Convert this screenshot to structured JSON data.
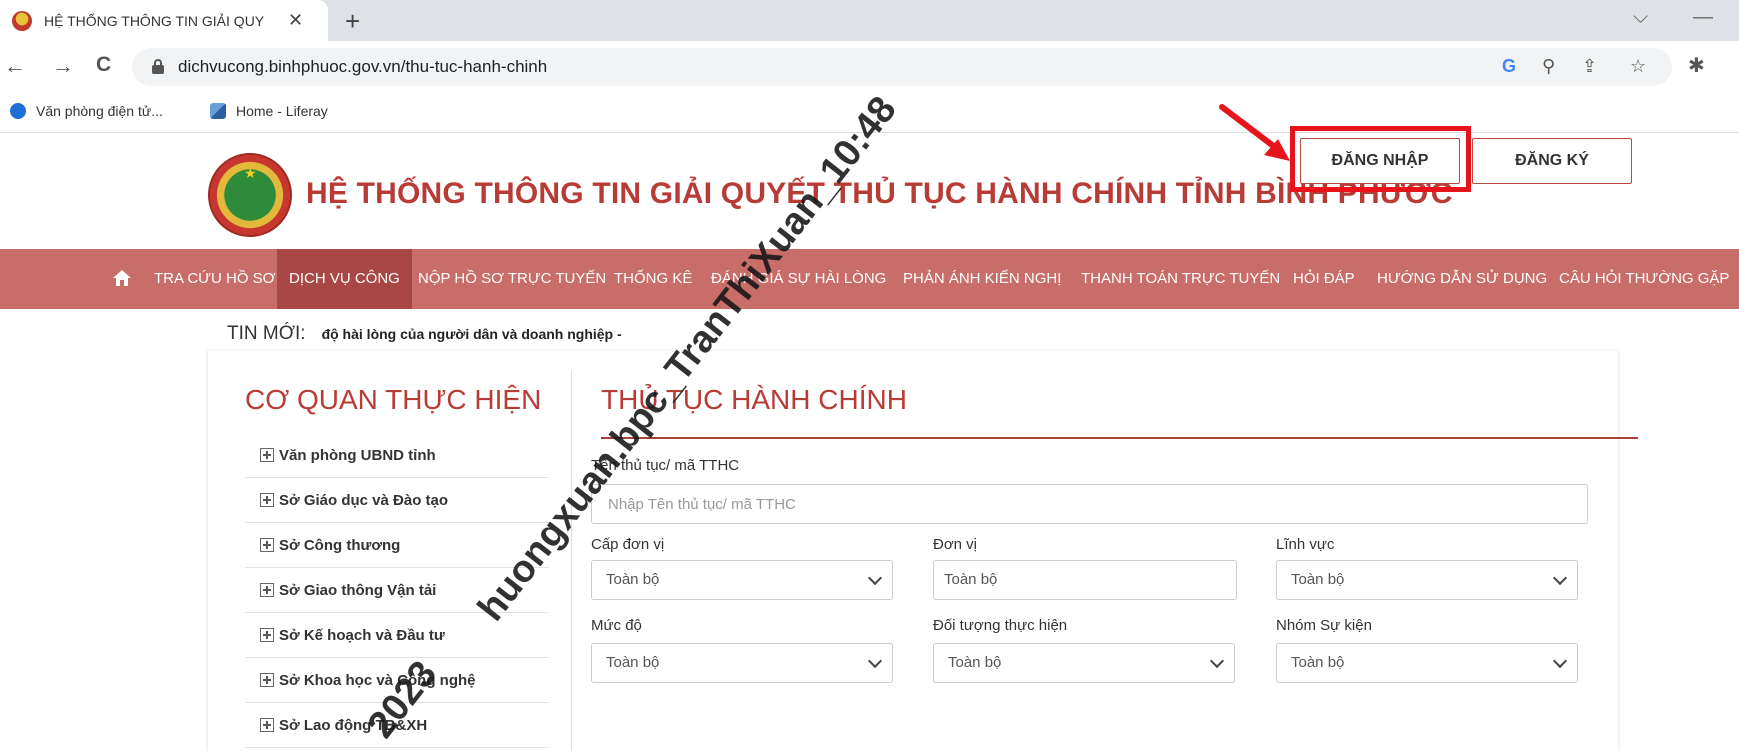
{
  "browser": {
    "tab_title": "HỆ THỐNG THÔNG TIN GIẢI QUY",
    "tab_close": "✕",
    "new_tab": "+",
    "minimize": "—",
    "dropdown": "⌵",
    "url": "dichvucong.binhphuoc.gov.vn/thu-tuc-hanh-chinh",
    "back": "←",
    "forward": "→",
    "reload": "C",
    "google": "G",
    "zoom": "⚲",
    "share": "⇪",
    "star": "☆",
    "extensions": "✱",
    "bookmarks": [
      {
        "label": "Văn phòng điện tử...",
        "icon": "shield-check-icon"
      },
      {
        "label": "Home - Liferay",
        "icon": "liferay-icon"
      }
    ]
  },
  "header": {
    "title": "HỆ THỐNG THÔNG TIN GIẢI QUYẾT THỦ TỤC HÀNH CHÍNH TỈNH BÌNH PHƯỚC",
    "login": "ĐĂNG NHẬP",
    "register": "ĐĂNG KÝ"
  },
  "nav": {
    "home_icon": "home-icon",
    "items": [
      "TRA CỨU HỒ SƠ",
      "DỊCH VỤ CÔNG",
      "NỘP HỒ SƠ TRỰC TUYẾN",
      "THỐNG KÊ",
      "ĐÁNH GIÁ SỰ HÀI LÒNG",
      "PHẢN ÁNH KIẾN NGHỊ",
      "THANH TOÁN TRỰC TUYẾN",
      "HỎI ĐÁP",
      "HƯỚNG DẪN SỬ DỤNG",
      "CÂU HỎI THƯỜNG GẶP"
    ],
    "active": "DỊCH VỤ CÔNG"
  },
  "news": {
    "label": "TIN MỚI:",
    "text": "độ hài lòng của người dân và doanh nghiệp -"
  },
  "agencies": {
    "title": "CƠ QUAN THỰC HIỆN",
    "items": [
      "Văn phòng UBND tỉnh",
      "Sở Giáo dục và Đào tạo",
      "Sở Công thương",
      "Sở Giao thông Vận tải",
      "Sở Kế hoạch và Đầu tư",
      "Sở Khoa học và Công nghệ",
      "Sở Lao động TB&XH"
    ]
  },
  "procedures": {
    "title": "THỦ TỤC HÀNH CHÍNH",
    "search_label": "Tên thủ tục/ mã TTHC",
    "search_placeholder": "Nhập Tên thủ tục/ mã TTHC",
    "filters": {
      "cap_don_vi": {
        "label": "Cấp đơn vị",
        "value": "Toàn bộ"
      },
      "don_vi": {
        "label": "Đơn vị",
        "value": "Toàn bộ"
      },
      "linh_vuc": {
        "label": "Lĩnh vực",
        "value": "Toàn bộ"
      },
      "muc_do": {
        "label": "Mức độ",
        "value": "Toàn bộ"
      },
      "doi_tuong": {
        "label": "Đối tượng thực hiện",
        "value": "Toàn bộ"
      },
      "nhom_su_kien": {
        "label": "Nhóm Sự kiện",
        "value": "Toàn bộ"
      }
    }
  },
  "watermark": {
    "line1": "huongxuan.bpc_TranThiXuan_10:48",
    "line2": "2023"
  },
  "colors": {
    "brand_red": "#b83b36",
    "nav_bg": "#c96d68",
    "nav_active": "#a84743",
    "highlight": "#e8141b"
  }
}
